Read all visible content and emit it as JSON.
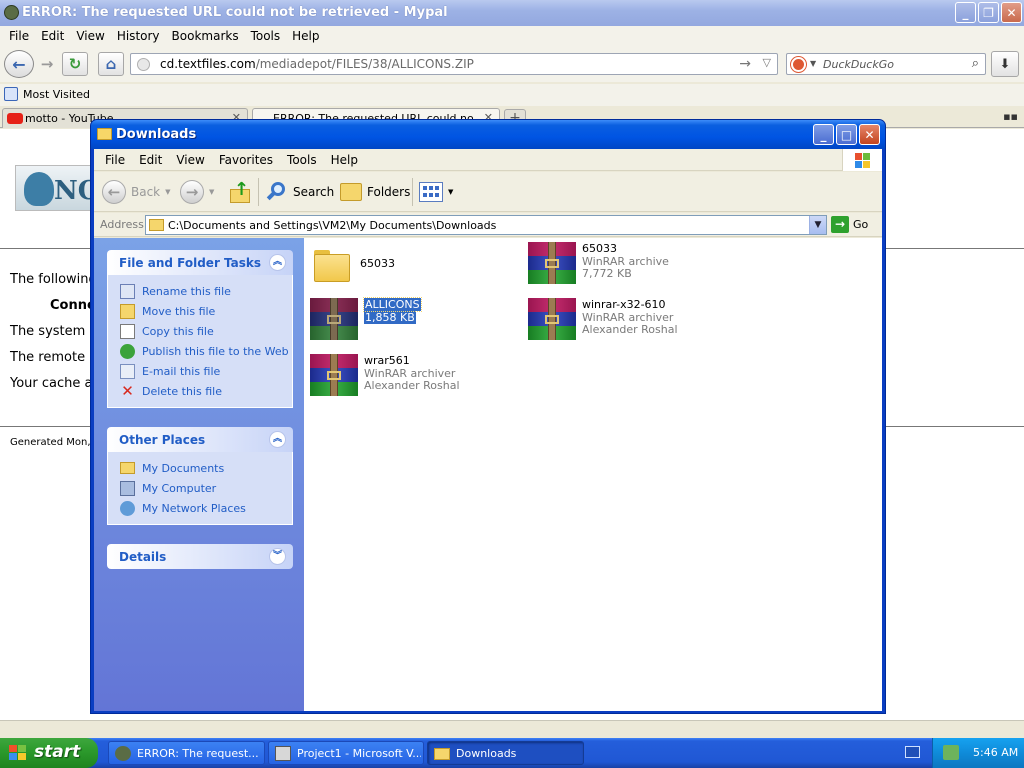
{
  "browser": {
    "title": "ERROR: The requested URL could not be retrieved - Mypal",
    "menu": [
      "File",
      "Edit",
      "View",
      "History",
      "Bookmarks",
      "Tools",
      "Help"
    ],
    "url_domain": "cd.textfiles.com",
    "url_path": "/mediadepot/FILES/38/ALLICONS.ZIP",
    "search_placeholder": "DuckDuckGo",
    "bookmarks_label": "Most Visited",
    "tabs": [
      {
        "label": "motto - YouTube"
      },
      {
        "label": "ERROR: The requested URL could not be"
      }
    ],
    "content": {
      "logo_text": "NOV",
      "line1": "The following",
      "line2": "Conne",
      "line3": "The system r",
      "line4": "The remote h",
      "line5": "Your cache a",
      "generated": "Generated Mon,"
    }
  },
  "explorer": {
    "title": "Downloads",
    "menu": [
      "File",
      "Edit",
      "View",
      "Favorites",
      "Tools",
      "Help"
    ],
    "toolbar": {
      "back": "Back",
      "search": "Search",
      "folders": "Folders"
    },
    "address_label": "Address",
    "address_path": "C:\\Documents and Settings\\VM2\\My Documents\\Downloads",
    "go_label": "Go",
    "tasks_panel": {
      "title": "File and Folder Tasks",
      "items": [
        {
          "label": "Rename this file",
          "icon": "rename-icon"
        },
        {
          "label": "Move this file",
          "icon": "move-icon"
        },
        {
          "label": "Copy this file",
          "icon": "copy-icon"
        },
        {
          "label": "Publish this file to the Web",
          "icon": "publish-icon"
        },
        {
          "label": "E-mail this file",
          "icon": "email-icon"
        },
        {
          "label": "Delete this file",
          "icon": "delete-icon"
        }
      ]
    },
    "places_panel": {
      "title": "Other Places",
      "items": [
        {
          "label": "My Documents",
          "icon": "my-documents-icon"
        },
        {
          "label": "My Computer",
          "icon": "my-computer-icon"
        },
        {
          "label": "My Network Places",
          "icon": "network-places-icon"
        }
      ]
    },
    "details_panel": {
      "title": "Details"
    },
    "files": [
      {
        "name": "65033",
        "line2": "",
        "line3": "",
        "type": "folder"
      },
      {
        "name": "65033",
        "line2": "WinRAR archive",
        "line3": "7,772 KB",
        "type": "rar"
      },
      {
        "name": "ALLICONS",
        "line2": "1,858 KB",
        "line3": "",
        "type": "rar",
        "selected": true
      },
      {
        "name": "winrar-x32-610",
        "line2": "WinRAR archiver",
        "line3": "Alexander Roshal",
        "type": "rar"
      },
      {
        "name": "wrar561",
        "line2": "WinRAR archiver",
        "line3": "Alexander Roshal",
        "type": "rar"
      }
    ]
  },
  "taskbar": {
    "start_label": "start",
    "tasks": [
      {
        "label": "ERROR: The request..."
      },
      {
        "label": "Project1 - Microsoft V..."
      },
      {
        "label": "Downloads"
      }
    ],
    "clock": "5:46 AM"
  },
  "colors": {
    "xp_blue": "#0054e3",
    "task_link": "#215dc6",
    "selection": "#316ac5",
    "start_green": "#2d9b2d"
  }
}
